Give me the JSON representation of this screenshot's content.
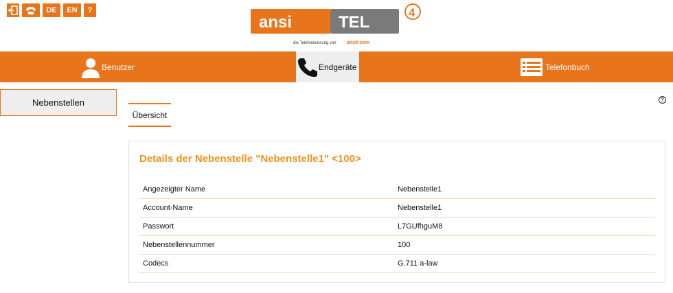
{
  "topbar": {
    "icons": [
      {
        "name": "logout-icon"
      },
      {
        "name": "phone-icon"
      }
    ],
    "lang_de": "DE",
    "lang_en": "EN",
    "help_label": "?"
  },
  "logo": {
    "brand_left": "ansi",
    "brand_right": "TEL",
    "version": "4",
    "tagline": "die Telefonielösung von",
    "tagline_brand": "ansit-com"
  },
  "nav": {
    "items": [
      {
        "label": "Benutzer",
        "icon": "user-icon"
      },
      {
        "label": "Endgeräte",
        "icon": "handset-icon"
      },
      {
        "label": "Telefonbuch",
        "icon": "phonebook-icon"
      }
    ],
    "active": "Endgeräte"
  },
  "sidebar": {
    "items": [
      {
        "label": "Nebenstellen"
      }
    ]
  },
  "help": {
    "label": "?"
  },
  "tabs": [
    {
      "label": "Übersicht"
    }
  ],
  "details": {
    "title": "Details der Nebenstelle \"Nebenstelle1\" <100>",
    "rows": [
      {
        "key": "Angezeigter Name",
        "value": "Nebenstelle1"
      },
      {
        "key": "Account-Name",
        "value": "Nebenstelle1"
      },
      {
        "key": "Passwort",
        "value": "L7GUfhguM8"
      },
      {
        "key": "Nebenstellennummer",
        "value": "100"
      },
      {
        "key": "Codecs",
        "value": "G.711 a-law"
      }
    ]
  },
  "colors": {
    "accent": "#e8741c",
    "title": "#f0921e",
    "active_bg": "#eeeeee"
  }
}
